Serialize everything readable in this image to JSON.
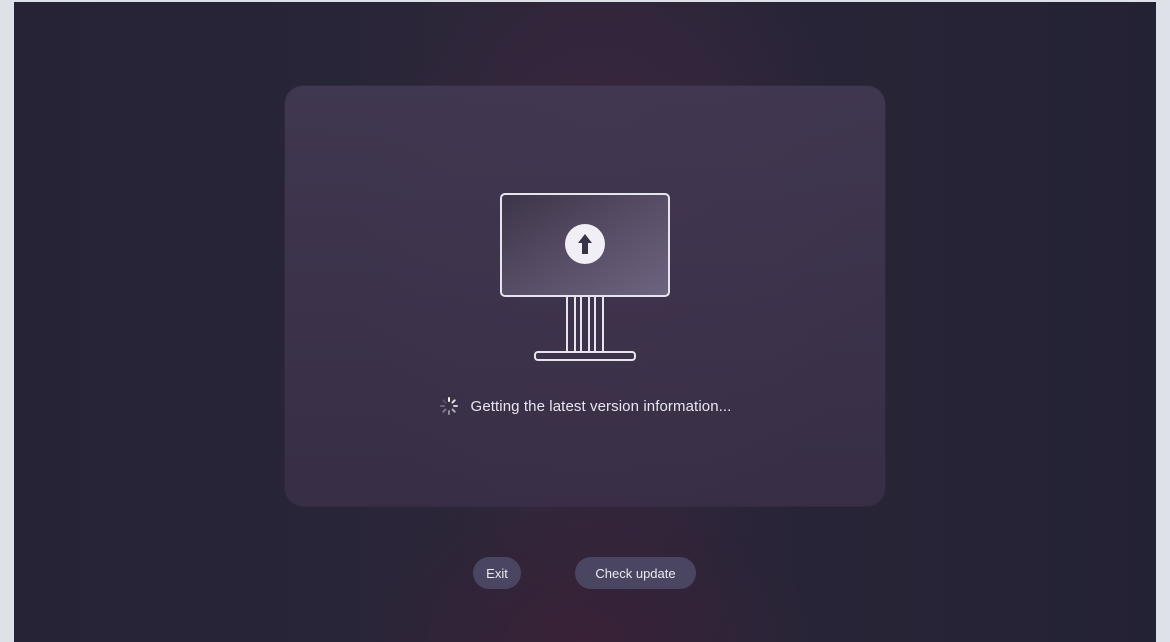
{
  "dialog": {
    "status_text": "Getting the latest version information...",
    "illustration_icon": "monitor-upload-icon",
    "loading_icon": "spinner-icon"
  },
  "actions": {
    "exit_label": "Exit",
    "check_update_label": "Check update"
  },
  "colors": {
    "background": "#2a2538",
    "card": "#3f3650",
    "button": "#4a4560",
    "text": "#e9e6ef"
  }
}
